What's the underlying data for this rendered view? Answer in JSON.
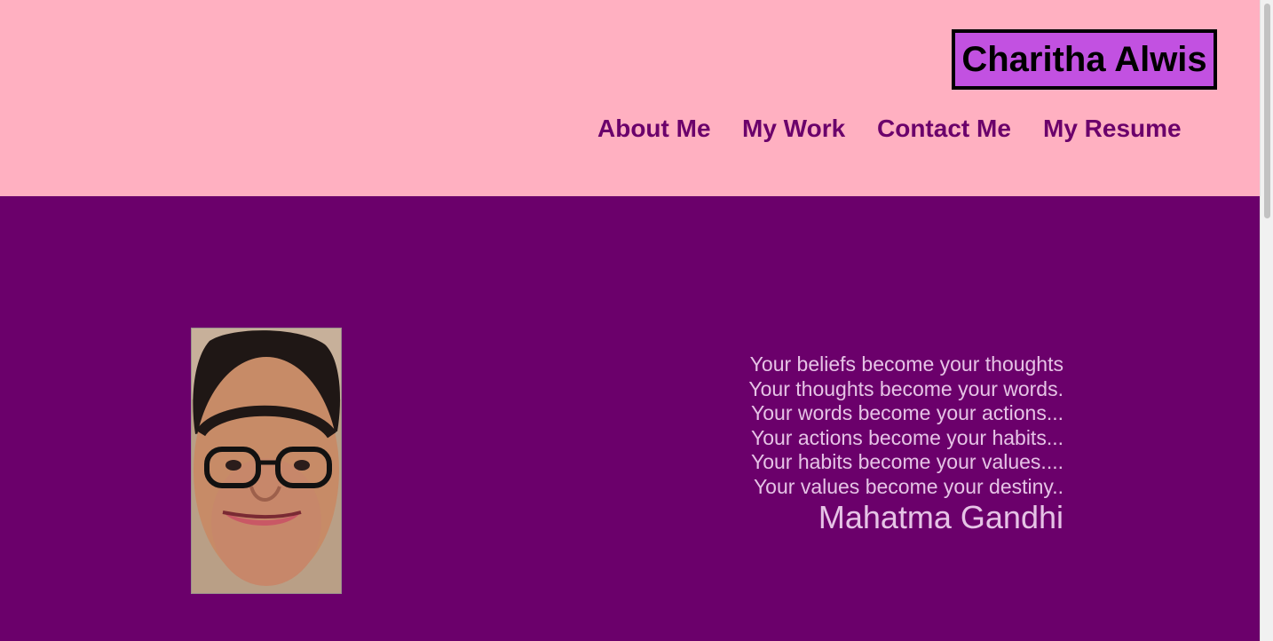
{
  "header": {
    "brand": "Charitha Alwis",
    "nav": [
      "About Me",
      "My Work",
      "Contact Me",
      "My Resume"
    ]
  },
  "hero": {
    "photo_alt": "Portrait photo",
    "quote": {
      "lines": [
        "Your beliefs become your thoughts",
        "Your thoughts become your words.",
        "Your words become your actions...",
        "Your actions become your habits...",
        "Your habits become your values....",
        "Your values become your destiny.."
      ],
      "author": "Mahatma Gandhi"
    }
  },
  "colors": {
    "header_bg": "#ffb0c1",
    "brand_bg": "#c251e1",
    "primary_purple": "#6b006b",
    "quote_text": "#e6c3e6"
  }
}
